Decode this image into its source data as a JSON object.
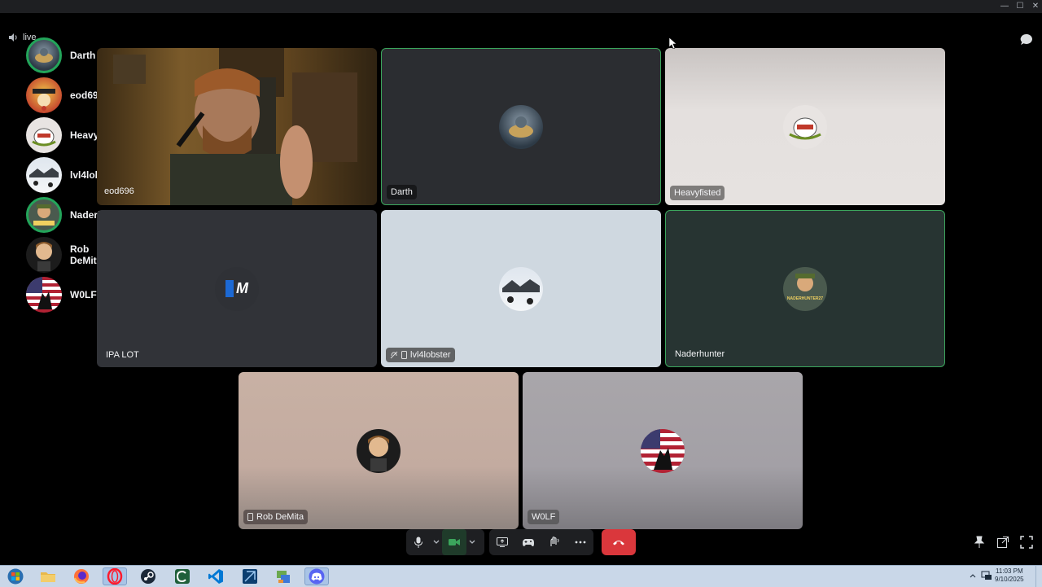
{
  "window": {
    "minimize_glyph": "—",
    "maximize_glyph": "☐",
    "close_glyph": "✕"
  },
  "channel": {
    "name": "live",
    "icon": "speaker-icon"
  },
  "participants": [
    {
      "name": "Darth",
      "speaking": true
    },
    {
      "name": "eod696",
      "speaking": false
    },
    {
      "name": "Heavyfisted",
      "speaking": false
    },
    {
      "name": "lvl4lobster",
      "speaking": false
    },
    {
      "name": "Naderhunter",
      "speaking": true
    },
    {
      "name": "Rob DeMita",
      "speaking": false
    },
    {
      "name": "W0LF",
      "speaking": false
    }
  ],
  "tiles": {
    "eod696": {
      "label": "eod696",
      "type": "video"
    },
    "darth": {
      "label": "Darth",
      "active": true
    },
    "heavyfisted": {
      "label": "Heavyfisted"
    },
    "ipalot": {
      "label": "IPA LOT",
      "avatar_text": "M"
    },
    "lvl4lobster": {
      "label": "lvl4lobster",
      "icons": [
        "deafened-icon",
        "mobile-icon"
      ]
    },
    "naderhunter": {
      "label": "Naderhunter",
      "active": true,
      "avatar_text": "NADERHUNTER27"
    },
    "robdemita": {
      "label": "Rob DeMita",
      "icons": [
        "mobile-icon"
      ]
    },
    "wolf": {
      "label": "W0LF"
    }
  },
  "controls": {
    "mic": "microphone-icon",
    "camera": "camera-icon",
    "screenshare": "screen-share-icon",
    "activities": "gamepad-icon",
    "soundboard": "soundboard-icon",
    "more": "more-icon",
    "disconnect": "hang-up-icon"
  },
  "taskbar": {
    "apps": [
      "start",
      "file-explorer",
      "firefox",
      "opera",
      "steam",
      "app-c",
      "vscode",
      "app-tool",
      "app-network",
      "discord"
    ],
    "active_app": "discord",
    "time": "11:03 PM",
    "date": "9/10/2025"
  },
  "colors": {
    "speaking": "#23a55a",
    "hangup": "#da373c",
    "background": "#000000"
  }
}
